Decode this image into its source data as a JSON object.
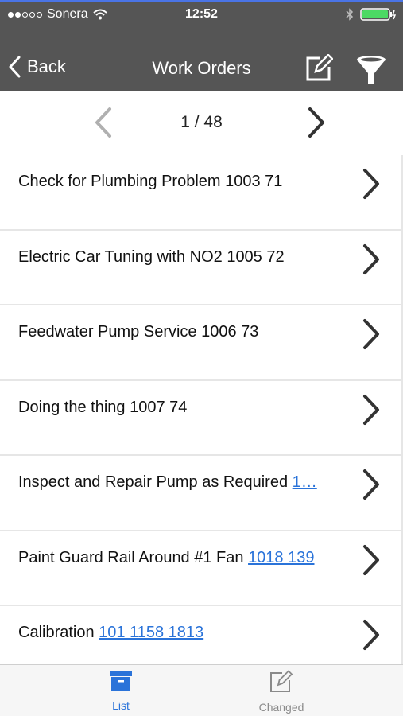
{
  "status_bar": {
    "carrier": "Sonera",
    "time": "12:52",
    "signal_filled": 2,
    "signal_empty": 3
  },
  "nav": {
    "back_label": "Back",
    "title": "Work Orders",
    "edit_icon": "edit-icon",
    "filter_icon": "filter-icon"
  },
  "pager": {
    "page_text": "1 / 48"
  },
  "work_orders": [
    {
      "text": "Check for Plumbing Problem 1003 71",
      "link": ""
    },
    {
      "text": "Electric Car Tuning with NO2 1005 72",
      "link": ""
    },
    {
      "text": "Feedwater Pump Service 1006 73",
      "link": ""
    },
    {
      "text": "Doing the thing 1007 74",
      "link": ""
    },
    {
      "text": "Inspect and Repair Pump as Required ",
      "link": "1…"
    },
    {
      "text": "Paint Guard Rail Around #1 Fan ",
      "link": "1018 139"
    },
    {
      "text": "Calibration ",
      "link": "101 1158 1813"
    }
  ],
  "tabbar": {
    "list_label": "List",
    "changed_label": "Changed"
  },
  "colors": {
    "nav_bg": "#555555",
    "accent": "#2a73d9",
    "top_accent": "#4a74e6",
    "battery": "#4cd964"
  }
}
